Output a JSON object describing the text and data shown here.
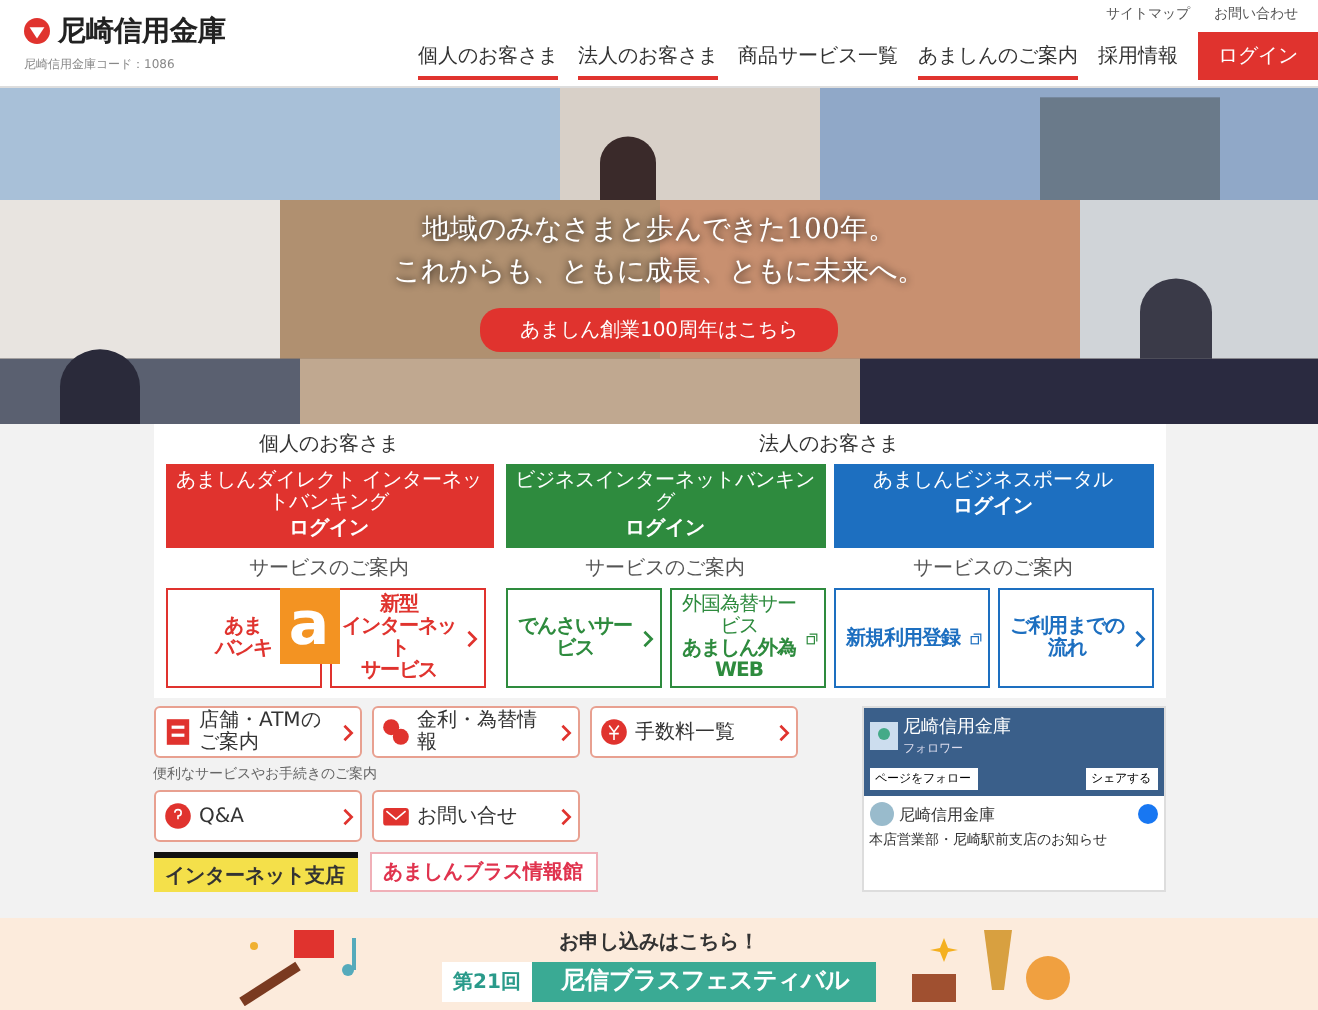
{
  "header": {
    "logo": "尼崎信用金庫",
    "subtitle": "尼崎信用金庫コード：1086",
    "top_links": [
      "サイトマップ",
      "お問い合わせ"
    ],
    "nav": [
      {
        "label": "個人のお客さま",
        "has_menu": true
      },
      {
        "label": "法人のお客さま",
        "has_menu": true
      },
      {
        "label": "商品サービス一覧",
        "has_menu": false
      },
      {
        "label": "あましんのご案内",
        "has_menu": true
      },
      {
        "label": "採用情報",
        "has_menu": false
      }
    ],
    "login_button": "ログイン"
  },
  "hero": {
    "kind": "picture",
    "headline": [
      "地域のみなさまと歩んできた100年。",
      "これからも、ともに成長、ともに未来へ。"
    ],
    "button": "あましん創業100周年はこちら"
  },
  "login_panel": {
    "sections": [
      {
        "title": "個人のお客さま",
        "logins": [
          {
            "name": "あましんダイレクト インターネットバンキング",
            "action": "ログイン",
            "color": "#e0332e"
          }
        ],
        "service_link": "サービスのご案内",
        "services": [
          {
            "lines": [
              "あま",
              "バンキ"
            ],
            "kind": "plain"
          },
          {
            "lines": [
              "新型",
              "インターネット",
              "サービス"
            ],
            "kind": "arrow"
          }
        ]
      },
      {
        "title": "法人のお客さま",
        "logins": [
          {
            "name": "ビジネスインターネットバンキング",
            "action": "ログイン",
            "color": "#2e8b3e"
          },
          {
            "name": "あましんビジネスポータル",
            "action": "ログイン",
            "color": "#1d6fc0"
          }
        ],
        "service_link": "サービスのご案内",
        "services": [
          {
            "lines": [
              "でんさいサービス"
            ],
            "kind": "arrow"
          },
          {
            "note": "外国為替サービス",
            "lines": [
              "あましん外為WEB"
            ],
            "kind": "external"
          },
          {
            "lines": [
              "新規利用登録"
            ],
            "kind": "external"
          },
          {
            "lines": [
              "ご利用までの流れ"
            ],
            "kind": "arrow"
          }
        ],
        "service_link_2": "サービスのご案内"
      }
    ]
  },
  "badge": "a",
  "quick_links": [
    {
      "text": "店舗・ATMのご案内"
    },
    {
      "text": "金利・為替情報"
    },
    {
      "text": "手数料一覧"
    }
  ],
  "quick_caption": "便利なサービスやお手続きのご案内",
  "quick_links_2": [
    {
      "text": "Q&A"
    },
    {
      "text": "お問い合せ"
    }
  ],
  "facebook": {
    "page_name": "尼崎信用金庫",
    "followers": "フォロワー",
    "follow": "ページをフォロー",
    "share": "シェアする",
    "post_author": "尼崎信用金庫",
    "post_text": "本店営業部・尼崎駅前支店のお知らせ"
  },
  "banners": [
    {
      "text": "インターネット支店",
      "kind": "yellow"
    },
    {
      "text": "あましんブラス情報館",
      "kind": "pink"
    }
  ],
  "event_band": {
    "cta": "お申し込みはこちら！",
    "edition": "第21回",
    "title": "尼信ブラスフェスティバル"
  }
}
